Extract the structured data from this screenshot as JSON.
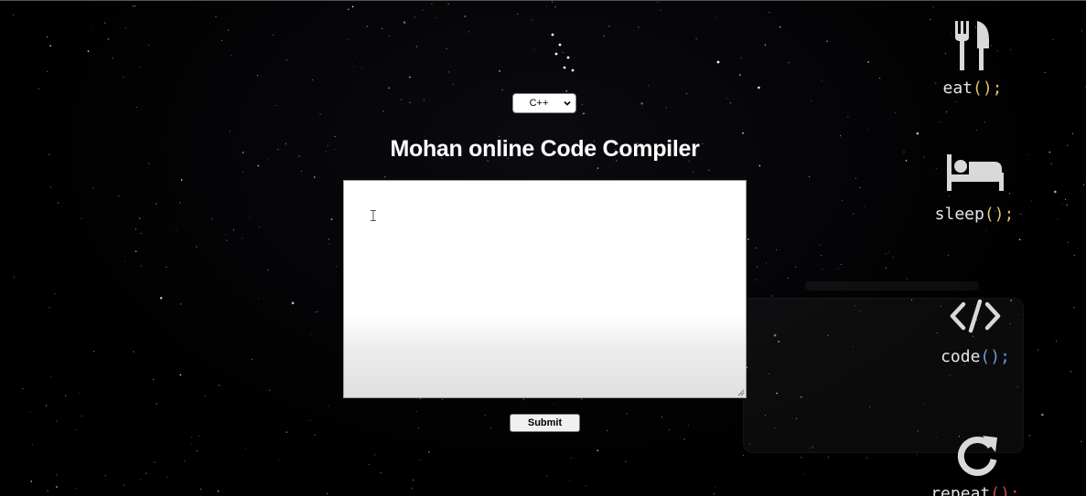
{
  "language_select": {
    "selected": "C++"
  },
  "page_title": "Mohan online Code Compiler",
  "editor": {
    "value": "",
    "placeholder": ""
  },
  "submit_label": "Submit",
  "mantras": [
    {
      "icon": "fork-knife-icon",
      "word": "eat",
      "parens": "();",
      "paren_color": "#e2c26a"
    },
    {
      "icon": "bed-icon",
      "word": "sleep",
      "parens": "();",
      "paren_color": "#e2c26a"
    },
    {
      "icon": "code-brackets-icon",
      "word": "code",
      "parens": "();",
      "paren_color": "#6a9be2"
    },
    {
      "icon": "repeat-icon",
      "word": "repeat",
      "parens": "();",
      "paren_color": "#c94a4a"
    }
  ],
  "colors": {
    "background": "#000000",
    "title": "#ffffff",
    "mantra_text": "#e6e6e6",
    "mantra_icon": "#d9d9d9"
  }
}
